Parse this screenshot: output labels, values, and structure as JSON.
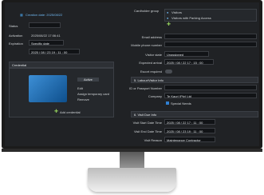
{
  "left": {
    "created_label": "Creation date: 2025/08/22",
    "status_label": "Status",
    "status_value": "",
    "activation_label": "Activation",
    "activation_value": "2025/08/22 17:06:41",
    "expiration_label": "Expiration",
    "expiration_type": "Specific date",
    "expiration_datetime": "2025 / 08 / 23   19 : 11 : 00",
    "card_section_label": "Credential",
    "card_status": "Active",
    "card_actions": [
      "Edit",
      "Assign temporary card",
      "Remove"
    ],
    "add_credential_label": "Add credential"
  },
  "right": {
    "cardholder_group_label": "Cardholder group",
    "groups": [
      "Visitors",
      "Visitors with Parking Access"
    ],
    "email_label": "Email address",
    "mobile_label": "Mobile phone number",
    "visitor_state_label": "Visitor state",
    "visitor_state_value": "Unassigned",
    "expected_arrival_label": "Expected arrival",
    "expected_arrival_value": "2025 / 08 / 22   17 : 15 : 00",
    "escort_label": "Escort required",
    "section_info": "5. Labour/Visitor Info",
    "id_label": "ID or Passport Number",
    "company_label": "Company",
    "company_value": "Te Kauri (Pty) Ltd",
    "special_needs_label": "Special Needs",
    "section_visit": "6. Visit Due Info",
    "visit_start_label": "Visit Start Date Time",
    "visit_start_value": "2025 / 08 / 22   17 : 11 : 00",
    "visit_end_label": "Visit End Date Time",
    "visit_end_value": "2025 / 08 / 23   19 : 11 : 00",
    "visit_reason_label": "Visit Reason",
    "visit_reason_value": "Maintenance Contractor"
  }
}
